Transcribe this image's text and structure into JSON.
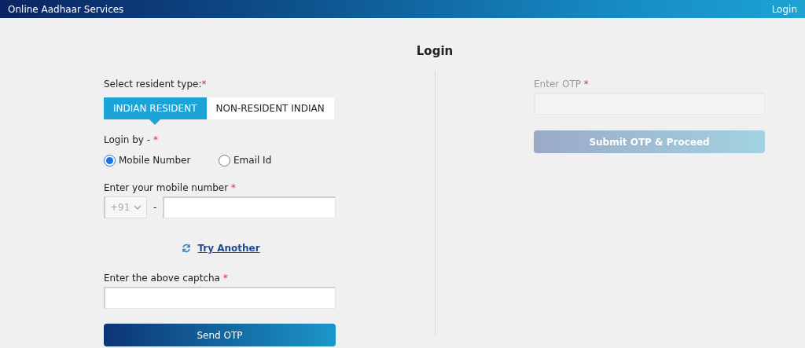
{
  "header": {
    "title": "Online Aadhaar Services",
    "login_link": "Login"
  },
  "page_title": "Login",
  "left": {
    "resident_type_label": {
      "text": "Select resident type:",
      "required_mark": "*"
    },
    "tabs": [
      {
        "label": "INDIAN RESIDENT",
        "selected": true
      },
      {
        "label": "NON-RESIDENT INDIAN",
        "selected": false
      }
    ],
    "login_by_label": {
      "text": "Login by - ",
      "required_mark": "*"
    },
    "login_options": [
      {
        "label": "Mobile Number",
        "selected": true
      },
      {
        "label": "Email Id",
        "selected": false
      }
    ],
    "mobile_label": {
      "text": "Enter your mobile number ",
      "required_mark": "*"
    },
    "country_code": "+91",
    "separator": "-",
    "try_another": "Try Another",
    "captcha_label": {
      "text": "Enter the above captcha ",
      "required_mark": "*"
    },
    "send_button": "Send OTP"
  },
  "right": {
    "otp_label": {
      "text": "Enter OTP ",
      "required_mark": "*"
    },
    "disabled": true,
    "submit_button": "Submit OTP & Proceed"
  }
}
